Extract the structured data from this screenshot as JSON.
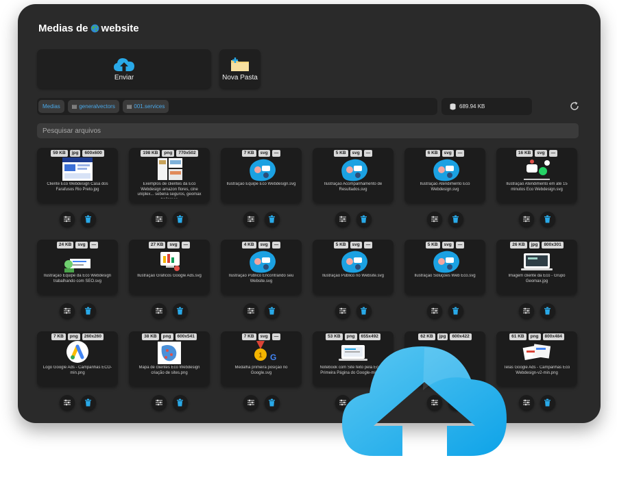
{
  "header": {
    "title_pre": "Medias de",
    "title_post": "website"
  },
  "toolbar": {
    "upload_label": "Enviar",
    "new_folder_label": "Nova Pasta"
  },
  "breadcrumb": [
    "Medias",
    "generalvectors",
    "001.services"
  ],
  "storage": {
    "used": "689.94 KB"
  },
  "search": {
    "placeholder": "Pesquisar arquivos"
  },
  "colors": {
    "panel": "#2a2a2a",
    "card": "#1c1c1c",
    "accent": "#1ba1e2",
    "link": "#4aa8e8"
  },
  "files": [
    {
      "size": "59 KB",
      "type": "jpg",
      "dims": "600x600",
      "name": "Cliente Eco Webdesign Casa dos Farafusos Rio Preto.jpg",
      "thumb": "web"
    },
    {
      "size": "198 KB",
      "type": "png",
      "dims": "770x502",
      "name": "Exemplos de clientes da Eco Webdesign amazon flores, cine uniplex... sebena seguros, geomax trailoreca",
      "thumb": "sheets"
    },
    {
      "size": "7 KB",
      "type": "svg",
      "dims": "—",
      "name": "Ilustração Equipe Eco Webdesign.svg",
      "thumb": "blob"
    },
    {
      "size": "5 KB",
      "type": "svg",
      "dims": "—",
      "name": "Ilustração Acompanhamento de Resultados.svg",
      "thumb": "blob"
    },
    {
      "size": "6 KB",
      "type": "svg",
      "dims": "—",
      "name": "Ilustração Atendimento Eco Webdesign.svg",
      "thumb": "blob"
    },
    {
      "size": "16 KB",
      "type": "svg",
      "dims": "—",
      "name": "Ilustração Atendimento em até 15 minutos Eco Webdesign.svg",
      "thumb": "chat"
    },
    {
      "size": "24 KB",
      "type": "svg",
      "dims": "—",
      "name": "Ilustração Equipe da Eco Webdesign trabalhando com SEO.svg",
      "thumb": "seo"
    },
    {
      "size": "27 KB",
      "type": "svg",
      "dims": "—",
      "name": "Ilustração Gráficos Google Ads.svg",
      "thumb": "ads"
    },
    {
      "size": "4 KB",
      "type": "svg",
      "dims": "—",
      "name": "Ilustração Público Encontrando seu Website.svg",
      "thumb": "blob"
    },
    {
      "size": "5 KB",
      "type": "svg",
      "dims": "—",
      "name": "Ilustração Público no Website.svg",
      "thumb": "blob"
    },
    {
      "size": "5 KB",
      "type": "svg",
      "dims": "—",
      "name": "Ilustração Soluções Web Eco.svg",
      "thumb": "blob"
    },
    {
      "size": "26 KB",
      "type": "jpg",
      "dims": "800x301",
      "name": "Imagem cliente da Eco - Grupo Geomax.jpg",
      "thumb": "laptop"
    },
    {
      "size": "7 KB",
      "type": "png",
      "dims": "260x260",
      "name": "Logo Google Ads - Campanhas ECO-min.png",
      "thumb": "gads"
    },
    {
      "size": "38 KB",
      "type": "png",
      "dims": "600x541",
      "name": "Mapa de clientes Eco Webdesign criação de sites.png",
      "thumb": "map"
    },
    {
      "size": "7 KB",
      "type": "svg",
      "dims": "—",
      "name": "Medalha primeira posição no Google.svg",
      "thumb": "medal"
    },
    {
      "size": "53 KB",
      "type": "png",
      "dims": "655x492",
      "name": "Notebook com Site feito pela Eco na Primeira Página do Google-min.png",
      "thumb": "notebook"
    },
    {
      "size": "62 KB",
      "type": "jpg",
      "dims": "600x422",
      "name": "",
      "thumb": "none"
    },
    {
      "size": "61 KB",
      "type": "png",
      "dims": "800x484",
      "name": "Telas Google Ads - Campanhas Eco Webdesign-v2-min.png",
      "thumb": "screens"
    }
  ]
}
